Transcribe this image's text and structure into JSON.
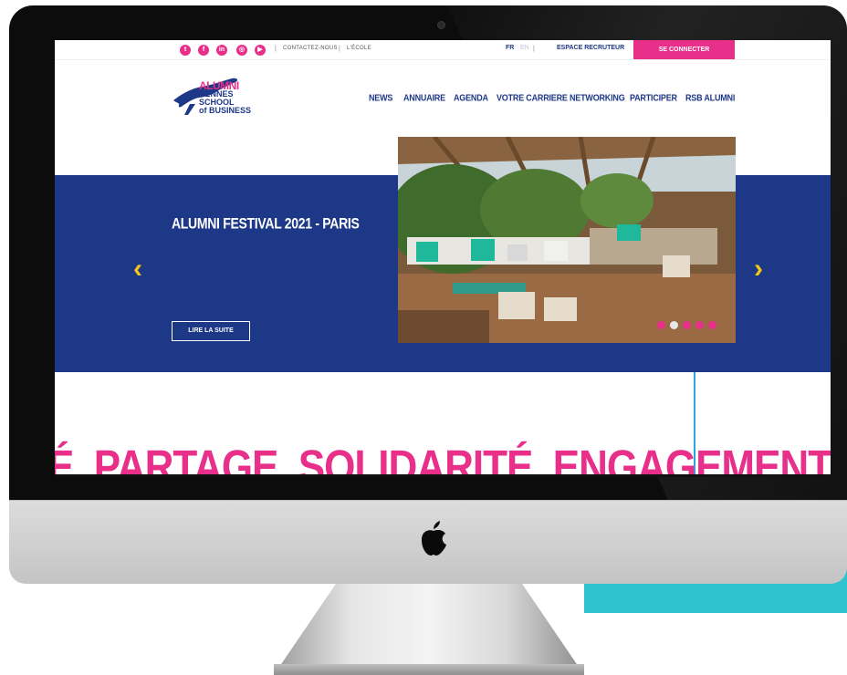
{
  "topbar": {
    "social": [
      {
        "icon": "twitter-icon",
        "glyph": "t"
      },
      {
        "icon": "facebook-icon",
        "glyph": "f"
      },
      {
        "icon": "linkedin-icon",
        "glyph": "in"
      },
      {
        "icon": "instagram-icon",
        "glyph": "◎"
      },
      {
        "icon": "youtube-icon",
        "glyph": "▶"
      }
    ],
    "contact": "CONTACTEZ-NOUS",
    "school": "L'ÉCOLE",
    "lang_fr": "FR",
    "lang_en": "EN",
    "recruiter": "ESPACE RECRUTEUR",
    "connect": "SE CONNECTER"
  },
  "logo": {
    "alumni": "ALUMNI",
    "line1": "RENNES",
    "line2": "SCHOOL",
    "line3": "of BUSINESS"
  },
  "nav": [
    "NEWS",
    "ANNUAIRE",
    "AGENDA",
    "VOTRE CARRIERE",
    "NETWORKING",
    "PARTICIPER",
    "RSB ALUMNI"
  ],
  "hero": {
    "title": "ALUMNI FESTIVAL 2021 - PARIS",
    "read_more": "LIRE LA SUITE",
    "prev_arrow": "‹",
    "next_arrow": "›",
    "slides_count": 5,
    "active_slide": 2
  },
  "values_text": "É. PARTAGE. SOLIDARITÉ. ENGAGEMENT. OUVERTURE. C",
  "colors": {
    "brand_blue": "#1e3888",
    "brand_pink": "#e8308a",
    "arrow_yellow": "#f5c518",
    "accent_teal": "#2fc3cf"
  }
}
